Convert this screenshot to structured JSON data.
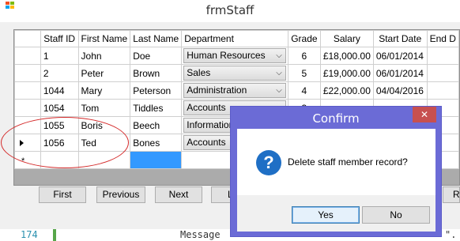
{
  "window": {
    "title": "frmStaff"
  },
  "grid": {
    "columns": [
      "Staff ID",
      "First Name",
      "Last Name",
      "Department",
      "Grade",
      "Salary",
      "Start Date",
      "End D"
    ],
    "rows": [
      {
        "staff_id": "1",
        "first_name": "John",
        "last_name": "Doe",
        "department": "Human Resources",
        "grade": "6",
        "salary": "£18,000.00",
        "start_date": "06/01/2014"
      },
      {
        "staff_id": "2",
        "first_name": "Peter",
        "last_name": "Brown",
        "department": "Sales",
        "grade": "5",
        "salary": "£19,000.00",
        "start_date": "06/01/2014"
      },
      {
        "staff_id": "1044",
        "first_name": "Mary",
        "last_name": "Peterson",
        "department": "Administration",
        "grade": "4",
        "salary": "£22,000.00",
        "start_date": "04/04/2016"
      },
      {
        "staff_id": "1054",
        "first_name": "Tom",
        "last_name": "Tiddles",
        "department": "Accounts",
        "grade": "3",
        "salary": "",
        "start_date": ""
      },
      {
        "staff_id": "1055",
        "first_name": "Boris",
        "last_name": "Beech",
        "department": "Information",
        "grade": "",
        "salary": "",
        "start_date": ""
      },
      {
        "staff_id": "1056",
        "first_name": "Ted",
        "last_name": "Bones",
        "department": "Accounts",
        "grade": "",
        "salary": "",
        "start_date": ""
      }
    ],
    "new_row_marker": "*",
    "current_row_index": 5
  },
  "nav_buttons": {
    "first": "First",
    "previous": "Previous",
    "next": "Next",
    "last_partial": "L",
    "right_partial": "R"
  },
  "editor": {
    "line_number": "174",
    "code_fragment": "Message",
    "code_tail": "\"."
  },
  "dialog": {
    "title": "Confirm",
    "close_glyph": "✕",
    "icon_glyph": "?",
    "message": "Delete staff member record?",
    "yes_label": "Yes",
    "no_label": "No"
  },
  "colors": {
    "dialog_frame": "#6b6bd6",
    "close_button": "#c75050",
    "selection": "#3399ff",
    "annotation": "#d42a2a",
    "question_icon": "#1f6fc5"
  }
}
